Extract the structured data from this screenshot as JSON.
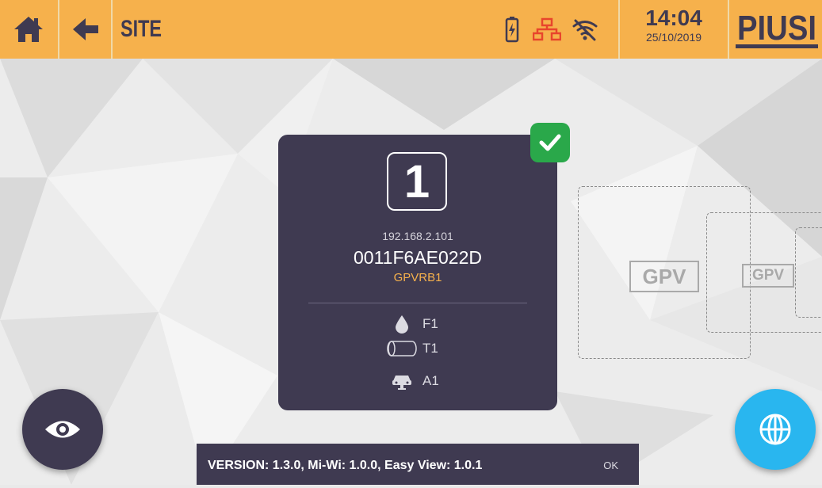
{
  "header": {
    "title": "SITE",
    "time": "14:04",
    "date": "25/10/2019",
    "logo_text": "PIUSI",
    "icons": [
      "home-icon",
      "back-arrow-icon",
      "battery-icon",
      "network-icon",
      "wifi-off-icon"
    ]
  },
  "card": {
    "number": "1",
    "ip": "192.168.2.101",
    "mac": "0011F6AE022D",
    "model": "GPVRB1",
    "items": [
      {
        "icon": "fuel-drop-icon",
        "label": "F1"
      },
      {
        "icon": "tank-icon",
        "label": "T1"
      },
      {
        "icon": "vehicle-icon",
        "label": "A1"
      }
    ],
    "status": "connected"
  },
  "placeholders": [
    "GPV",
    "GPV"
  ],
  "version_bar": {
    "text": "VERSION: 1.3.0, Mi-Wi: 1.0.0, Easy View: 1.0.1",
    "ok_label": "OK"
  },
  "colors": {
    "header": "#f6b14c",
    "card": "#3f3a51",
    "accent": "#f6b14c",
    "check": "#2aa84a",
    "network_fab": "#29b6ef",
    "network_icon": "#e8452c"
  }
}
